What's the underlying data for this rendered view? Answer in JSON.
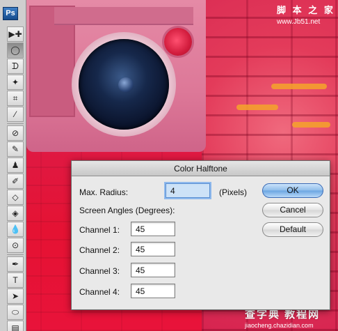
{
  "app": {
    "logo_text": "Ps"
  },
  "branding": {
    "top_cn": "脚 本 之 家",
    "top_url": "www.Jb51.net",
    "bottom_cn": "查字典 教程网",
    "bottom_url": "jiaocheng.chazidian.com"
  },
  "tools": [
    {
      "name": "move-tool-icon",
      "glyph": "▶✚"
    },
    {
      "name": "marquee-tool-icon",
      "glyph": "◯",
      "active": true
    },
    {
      "name": "lasso-tool-icon",
      "glyph": "ᗪ"
    },
    {
      "name": "magic-wand-tool-icon",
      "glyph": "✦"
    },
    {
      "name": "crop-tool-icon",
      "glyph": "⌗"
    },
    {
      "name": "eyedropper-tool-icon",
      "glyph": "⁄"
    },
    {
      "name": "healing-brush-tool-icon",
      "glyph": "⊘"
    },
    {
      "name": "brush-tool-icon",
      "glyph": "✎"
    },
    {
      "name": "clone-stamp-tool-icon",
      "glyph": "♟"
    },
    {
      "name": "history-brush-tool-icon",
      "glyph": "✐"
    },
    {
      "name": "eraser-tool-icon",
      "glyph": "◇"
    },
    {
      "name": "paint-bucket-tool-icon",
      "glyph": "◈"
    },
    {
      "name": "blur-tool-icon",
      "glyph": "💧"
    },
    {
      "name": "dodge-tool-icon",
      "glyph": "⊙"
    },
    {
      "name": "pen-tool-icon",
      "glyph": "✒"
    },
    {
      "name": "type-tool-icon",
      "glyph": "T"
    },
    {
      "name": "path-selection-tool-icon",
      "glyph": "➤"
    },
    {
      "name": "shape-tool-icon",
      "glyph": "⬭"
    },
    {
      "name": "notes-tool-icon",
      "glyph": "▤"
    }
  ],
  "dialog": {
    "title": "Color Halftone",
    "max_radius_label": "Max. Radius:",
    "max_radius_value": "4",
    "unit_label": "(Pixels)",
    "screen_angles_label": "Screen Angles (Degrees):",
    "channels": [
      {
        "label": "Channel 1:",
        "value": "45"
      },
      {
        "label": "Channel 2:",
        "value": "45"
      },
      {
        "label": "Channel 3:",
        "value": "45"
      },
      {
        "label": "Channel 4:",
        "value": "45"
      }
    ],
    "ok_label": "OK",
    "cancel_label": "Cancel",
    "default_label": "Default"
  },
  "colors": {
    "canvas_red": "#e8163a",
    "ok_button_blue": "#8dbce9",
    "toolbar_gray": "#cfcfcf"
  }
}
